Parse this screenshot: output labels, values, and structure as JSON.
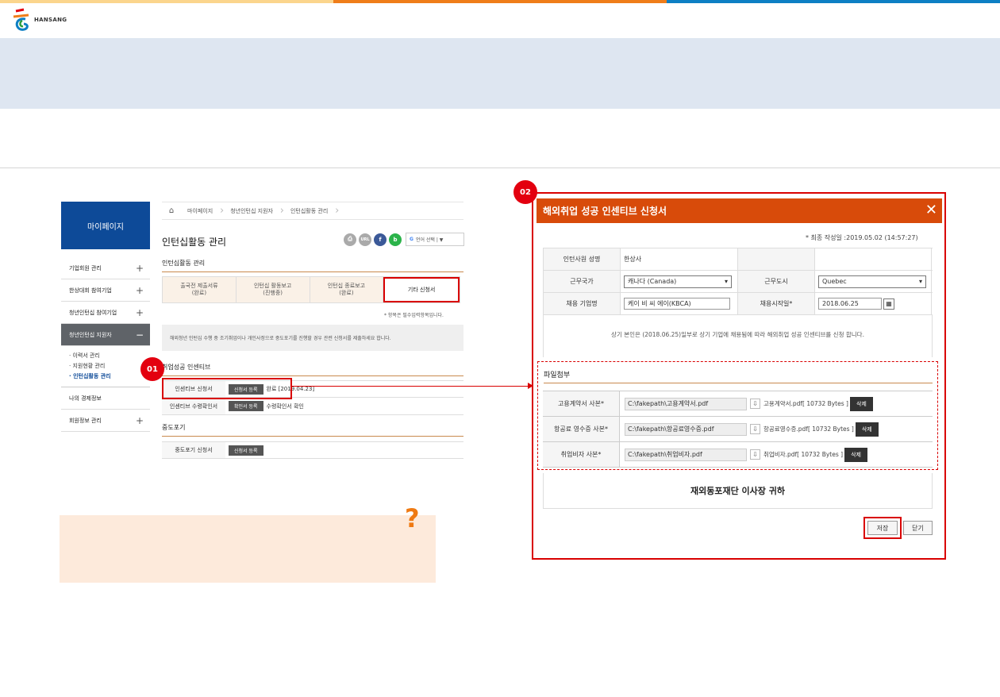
{
  "colors": {
    "bar1": "#fbd58d",
    "bar2": "#ef7d1a",
    "bar3": "#0d7fc4",
    "accent": "#d84b0a",
    "highlight": "#d90000"
  },
  "logo": {
    "text": "HANSANG"
  },
  "sidebar": {
    "title": "마이페이지",
    "items": [
      {
        "label": "기업회원 관리",
        "pm": "+"
      },
      {
        "label": "한상대회 참여기업",
        "pm": "+"
      },
      {
        "label": "청년인턴십 참여기업",
        "pm": "+"
      },
      {
        "label": "청년인턴십 지원자",
        "pm": "−"
      }
    ],
    "sub": [
      "· 이력서 관리",
      "· 지원현황 관리",
      "· 인턴십활동 관리"
    ],
    "items2": [
      {
        "label": "나의 경제정보"
      },
      {
        "label": "회원정보 관리",
        "pm": "+"
      }
    ]
  },
  "breadcrumb": {
    "home": "⌂",
    "items": [
      "마이페이지",
      "청년인턴십 지원자",
      "인턴십활동 관리"
    ]
  },
  "page": {
    "title": "인턴십활동 관리",
    "section1": "인턴십활동 관리",
    "tools": [
      "⎙",
      "URL",
      "f",
      "b"
    ],
    "lang": "언어 선택 | ▼",
    "tabs": [
      {
        "label": "출국전 제출서류\n(완료)"
      },
      {
        "label": "인턴십 활동보고\n(진행중)"
      },
      {
        "label": "인턴십 종료보고\n(완료)"
      },
      {
        "label": "기타 신청서"
      }
    ],
    "required_note": "* 항목은 필수입력항목입니다.",
    "notice": "해외청년 인턴십 수행 중 조기취업이나 개인사정으로 중도포기를 진행할 경우 관련 신청서를 제출하세요 합니다.",
    "section2": "취업성공 인센티브",
    "rows1": [
      {
        "label": "인센티브 신청서",
        "btn": "신청서 등록",
        "text": "완료 [2019.04.23]"
      },
      {
        "label": "인센티브 수령확인서",
        "btn": "확인서 등록",
        "text": "수령확인서 확인"
      }
    ],
    "section3": "중도포기",
    "rows2": [
      {
        "label": "중도포기 신청서",
        "btn": "신청서 등록",
        "text": ""
      }
    ]
  },
  "callouts": {
    "one": "01",
    "two": "02"
  },
  "modal": {
    "title": "해외취업 성공 인센티브 신청서",
    "close": "✕",
    "last_date": "* 최종 작성일 :2019.05.02 (14:57:27)",
    "name_label": "인턴사원 성명",
    "name_value": "한상사",
    "country_label": "근무국가",
    "country_value": "캐나다 (Canada)",
    "city_label": "근무도시",
    "city_value": "Quebec",
    "company_label": "채용 기업명",
    "company_value": "케이 비 씨 에이(KBCA)",
    "start_label": "채용시작일*",
    "start_value": "2018.06.25",
    "pledge": "상기 본인은 (2018.06.25)일부로 상기 기업에 채용됨에 따라 해외취업 성공 인센티브를 신청 합니다.",
    "file_title": "파일첨부",
    "files": [
      {
        "label": "고용계약서 사본*",
        "path": "C:\\fakepath\\고용계약서.pdf",
        "name": "고용계약서.pdf[ 10732 Bytes ]",
        "del": "삭제"
      },
      {
        "label": "항공료 영수증 사본*",
        "path": "C:\\fakepath\\항공료영수증.pdf",
        "name": "항공료영수증.pdf[ 10732 Bytes ]",
        "del": "삭제"
      },
      {
        "label": "취업비자 사본*",
        "path": "C:\\fakepath\\취업비자.pdf",
        "name": "취업비자.pdf[ 10732 Bytes ]",
        "del": "삭제"
      }
    ],
    "sign": "재외동포재단 이사장 귀하",
    "save": "저장",
    "close_btn": "닫기"
  },
  "qmark": "?"
}
